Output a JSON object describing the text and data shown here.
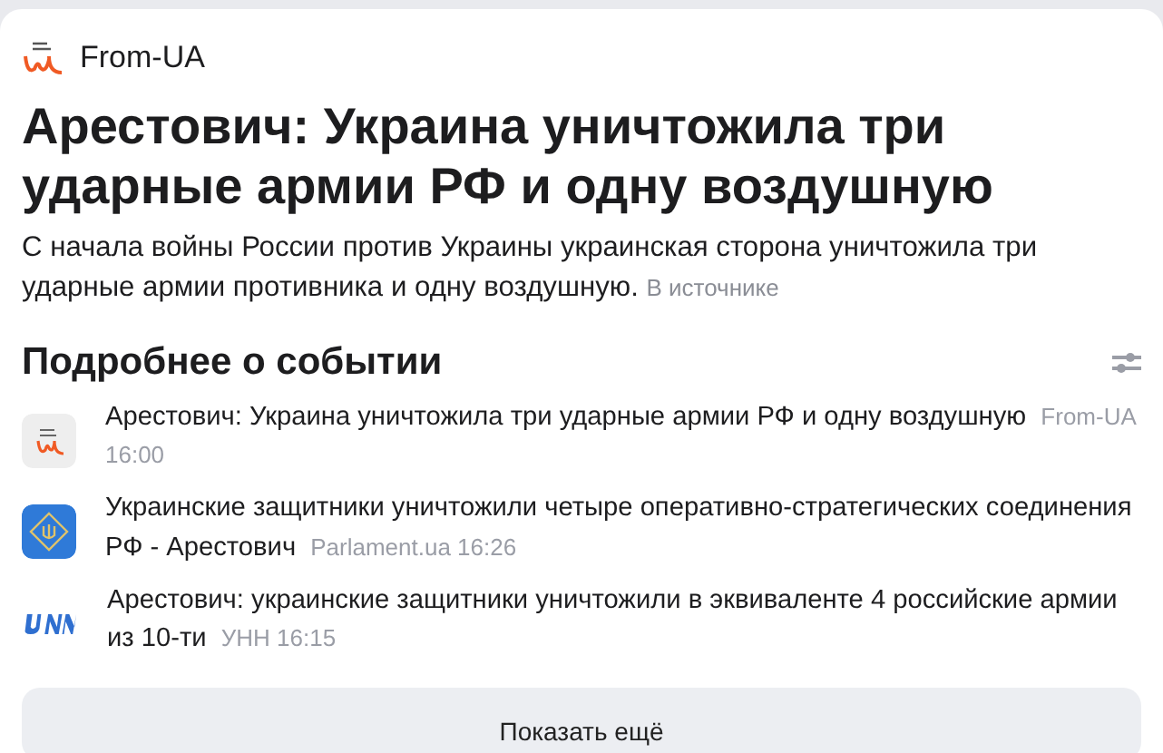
{
  "source": {
    "name": "From-UA"
  },
  "title": "Арестович: Украина уничтожила три ударные армии РФ и одну воздушную",
  "summary": {
    "text": "С начала войны России против Украины украинская сторона уничтожила три ударные армии противника и одну воздушную.",
    "link": "В источнике"
  },
  "section": {
    "title": "Подробнее о событии"
  },
  "stories": [
    {
      "kind": "fromua",
      "headline": "Арестович: Украина уничтожила три ударные армии РФ и одну воздушную",
      "source": "From-UA",
      "time": "16:00"
    },
    {
      "kind": "parlament",
      "headline": "Украинские защитники уничтожили четыре оперативно-стратегических соединения РФ - Арестович",
      "source": "Parlament.ua",
      "time": "16:26"
    },
    {
      "kind": "unn",
      "headline": "Арестович: украинские защитники уничтожили в эквиваленте 4 российские армии из 10-ти",
      "source": "УНН",
      "time": "16:15"
    }
  ],
  "more_button": "Показать ещё"
}
